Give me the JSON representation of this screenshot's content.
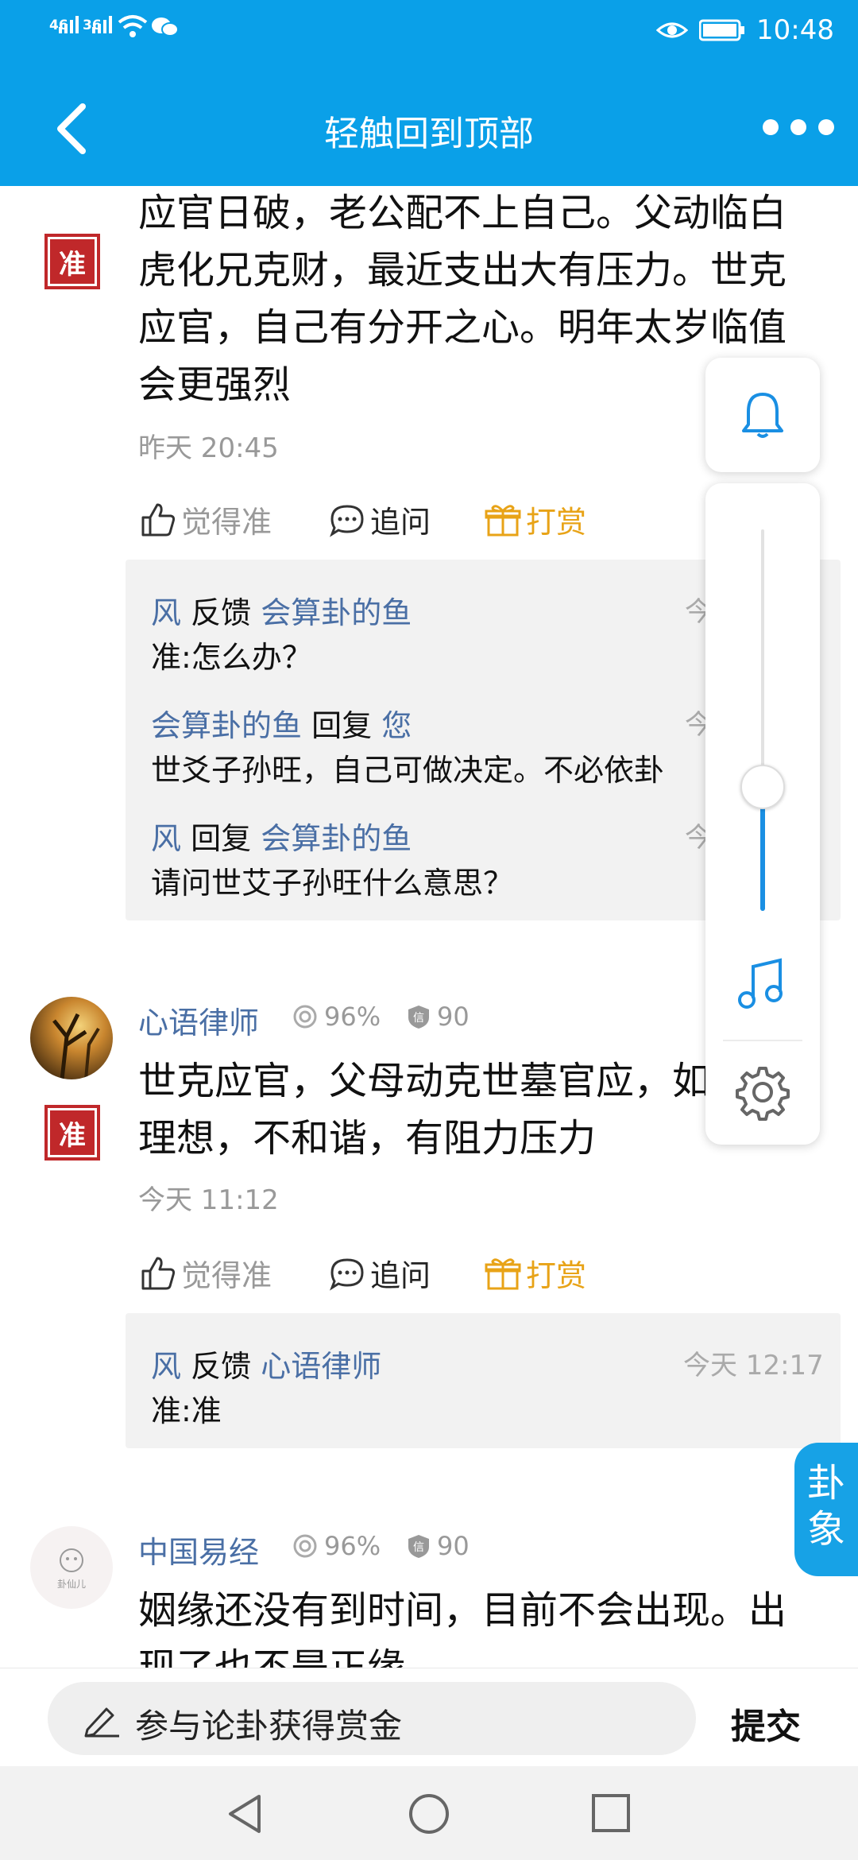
{
  "status_bar": {
    "net1": "46",
    "net2": "36",
    "time": "10:48"
  },
  "header": {
    "title": "轻触回到顶部"
  },
  "post1": {
    "badge": "准",
    "lines": [
      "应官日破，老公配不上自己。父动临白",
      "虎化兄克财，最近支出大有压力。世克",
      "应官，自己有分开之心。明年太岁临值",
      "会更强烈"
    ],
    "time": "昨天 20:45",
    "actions": {
      "agree": "觉得准",
      "ask": "追问",
      "reward": "打赏"
    },
    "replies": [
      {
        "from": "风",
        "verb": "反馈",
        "to": "会算卦的鱼",
        "time": "今",
        "text": "准:怎么办？"
      },
      {
        "from": "会算卦的鱼",
        "verb": "回复",
        "to": "您",
        "time": "今",
        "text": "世爻子孙旺，自己可做决定。不必依卦"
      },
      {
        "from": "风",
        "verb": "回复",
        "to": "会算卦的鱼",
        "time": "今",
        "text": "请问世艾子孙旺什么意思？"
      }
    ]
  },
  "post2": {
    "username": "心语律师",
    "rate": "96%",
    "credit": "90",
    "badge": "准",
    "lines": [
      "世克应官，父母动克世墓官应，如",
      "理想，不和谐，有阻力压力"
    ],
    "time": "今天 11:12",
    "actions": {
      "agree": "觉得准",
      "ask": "追问",
      "reward": "打赏"
    },
    "replies": [
      {
        "from": "风",
        "verb": "反馈",
        "to": "心语律师",
        "time": "今天 12:17",
        "text": "准:准"
      }
    ]
  },
  "post3": {
    "username": "中国易经",
    "rate": "96%",
    "credit": "90",
    "avatar_text": "卦仙儿",
    "lines": [
      "姻缘还没有到时间，目前不会出现。出",
      "现了也不是正缘"
    ]
  },
  "float_tab": {
    "line1": "卦",
    "line2": "象"
  },
  "volume": {
    "level": 0.33
  },
  "bottom": {
    "placeholder": "参与论卦获得赏金",
    "submit": "提交"
  },
  "colors": {
    "brand": "#0aa0e8",
    "link": "#4a6fa5",
    "reward": "#e8a317",
    "badge": "#c0282a"
  },
  "icons": [
    "back-icon",
    "more-icon",
    "bell-icon",
    "music-icon",
    "gear-icon",
    "thumbs-up-icon",
    "chat-icon",
    "gift-icon",
    "pencil-icon"
  ]
}
